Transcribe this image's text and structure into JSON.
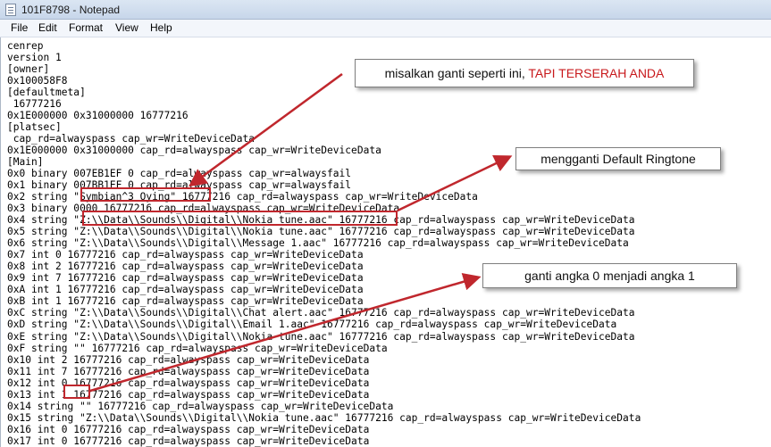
{
  "window": {
    "title": "101F8798 - Notepad"
  },
  "menu": [
    "File",
    "Edit",
    "Format",
    "View",
    "Help"
  ],
  "editor": {
    "lines": [
      "cenrep",
      "version 1",
      "[owner]",
      "0x100058F8",
      "[defaultmeta]",
      " 16777216",
      "0x1E000000 0x31000000 16777216",
      "[platsec]",
      " cap_rd=alwayspass cap_wr=WriteDeviceData",
      "0x1E000000 0x31000000 cap_rd=alwayspass cap_wr=WriteDeviceData",
      "[Main]",
      "0x0 binary 007EB1EF 0 cap_rd=alwayspass cap_wr=alwaysfail",
      "0x1 binary 007BB1EF 0 cap_rd=alwayspass cap_wr=alwaysfail",
      "0x2 string \"Symbian^3 Oying\" 16777216 cap_rd=alwayspass cap_wr=WriteDeviceData",
      "0x3 binary 0000 16777216 cap_rd=alwayspass cap_wr=WriteDeviceData",
      "0x4 string \"Z:\\\\Data\\\\Sounds\\\\Digital\\\\Nokia tune.aac\" 16777216 cap_rd=alwayspass cap_wr=WriteDeviceData",
      "0x5 string \"Z:\\\\Data\\\\Sounds\\\\Digital\\\\Nokia tune.aac\" 16777216 cap_rd=alwayspass cap_wr=WriteDeviceData",
      "0x6 string \"Z:\\\\Data\\\\Sounds\\\\Digital\\\\Message 1.aac\" 16777216 cap_rd=alwayspass cap_wr=WriteDeviceData",
      "0x7 int 0 16777216 cap_rd=alwayspass cap_wr=WriteDeviceData",
      "0x8 int 2 16777216 cap_rd=alwayspass cap_wr=WriteDeviceData",
      "0x9 int 7 16777216 cap_rd=alwayspass cap_wr=WriteDeviceData",
      "0xA int 1 16777216 cap_rd=alwayspass cap_wr=WriteDeviceData",
      "0xB int 1 16777216 cap_rd=alwayspass cap_wr=WriteDeviceData",
      "0xC string \"Z:\\\\Data\\\\Sounds\\\\Digital\\\\Chat alert.aac\" 16777216 cap_rd=alwayspass cap_wr=WriteDeviceData",
      "0xD string \"Z:\\\\Data\\\\Sounds\\\\Digital\\\\Email 1.aac\" 16777216 cap_rd=alwayspass cap_wr=WriteDeviceData",
      "0xE string \"Z:\\\\Data\\\\Sounds\\\\Digital\\\\Nokia tune.aac\" 16777216 cap_rd=alwayspass cap_wr=WriteDeviceData",
      "0xF string \"\" 16777216 cap_rd=alwayspass cap_wr=WriteDeviceData",
      "0x10 int 2 16777216 cap_rd=alwayspass cap_wr=WriteDeviceData",
      "0x11 int 7 16777216 cap_rd=alwayspass cap_wr=WriteDeviceData",
      "0x12 int 0 16777216 cap_rd=alwayspass cap_wr=WriteDeviceData",
      "0x13 int 1 16777216 cap_rd=alwayspass cap_wr=WriteDeviceData",
      "0x14 string \"\" 16777216 cap_rd=alwayspass cap_wr=WriteDeviceData",
      "0x15 string \"Z:\\\\Data\\\\Sounds\\\\Digital\\\\Nokia tune.aac\" 16777216 cap_rd=alwayspass cap_wr=WriteDeviceData",
      "0x16 int 0 16777216 cap_rd=alwayspass cap_wr=WriteDeviceData",
      "0x17 int 0 16777216 cap_rd=alwayspass cap_wr=WriteDeviceData"
    ]
  },
  "annotations": {
    "callout1_text": "misalkan ganti seperti ini, ",
    "callout1_highlight": "TAPI TERSERAH ANDA",
    "callout2_text": "mengganti Default Ringtone",
    "callout3_text": "ganti angka 0 menjadi angka 1",
    "highlight_color": "#c0272d",
    "arrow_color": "#c0272d"
  }
}
